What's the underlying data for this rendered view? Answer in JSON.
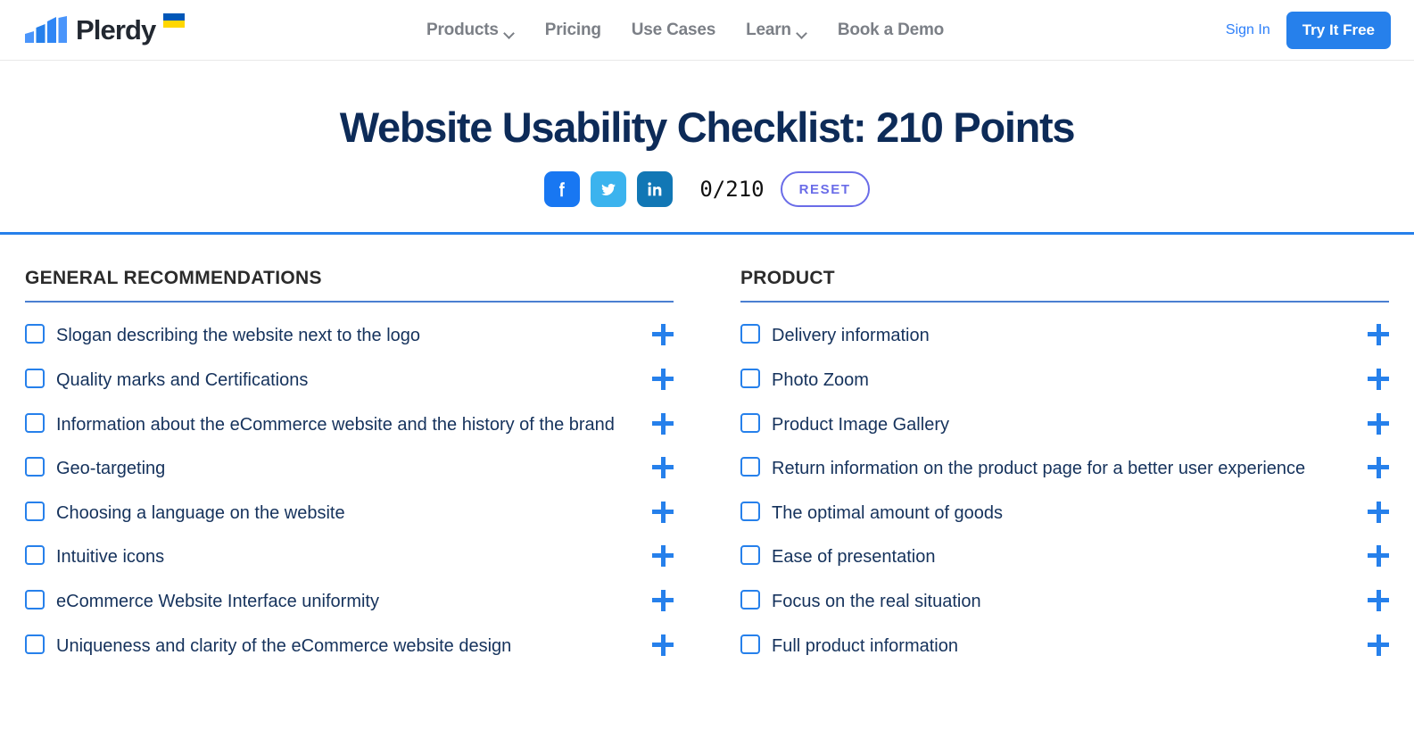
{
  "header": {
    "brand_name": "Plerdy",
    "brand_mark_icon": "bar-chart-logo-icon",
    "flag_icon": "ukraine-flag-icon",
    "nav": [
      {
        "label": "Products",
        "has_chevron": true
      },
      {
        "label": "Pricing",
        "has_chevron": false
      },
      {
        "label": "Use Cases",
        "has_chevron": false
      },
      {
        "label": "Learn",
        "has_chevron": true
      },
      {
        "label": "Book a Demo",
        "has_chevron": false
      }
    ],
    "sign_in_label": "Sign In",
    "cta_label": "Try It Free"
  },
  "hero": {
    "title": "Website Usability Checklist: 210 Points",
    "share": [
      {
        "network": "facebook",
        "icon": "facebook-icon",
        "color": "#1877f2"
      },
      {
        "network": "twitter",
        "icon": "twitter-icon",
        "color": "#3bb3ee"
      },
      {
        "network": "linkedin",
        "icon": "linkedin-icon",
        "color": "#1177b5"
      }
    ],
    "counter": "0/210",
    "reset_label": "RESET"
  },
  "colors": {
    "accent_blue": "#2680eb",
    "title_navy": "#0d2b58",
    "item_text": "#15325c",
    "reset_purple": "#6a6ce8",
    "nav_gray": "#7b7f86",
    "section_underline": "#4a7fd1"
  },
  "columns": [
    {
      "heading": "GENERAL RECOMMENDATIONS",
      "items": [
        {
          "label": "Slogan describing the website next to the logo",
          "checked": false
        },
        {
          "label": "Quality marks and Certifications",
          "checked": false
        },
        {
          "label": "Information about the eCommerce website and the history of the brand",
          "checked": false
        },
        {
          "label": "Geo-targeting",
          "checked": false
        },
        {
          "label": "Choosing a language on the website",
          "checked": false
        },
        {
          "label": "Intuitive icons",
          "checked": false
        },
        {
          "label": "eCommerce Website Interface uniformity",
          "checked": false
        },
        {
          "label": "Uniqueness and clarity of the eCommerce website design",
          "checked": false
        }
      ]
    },
    {
      "heading": "PRODUCT",
      "items": [
        {
          "label": "Delivery information",
          "checked": false
        },
        {
          "label": "Photo Zoom",
          "checked": false
        },
        {
          "label": "Product Image Gallery",
          "checked": false
        },
        {
          "label": "Return information on the product page for a better user experience",
          "checked": false
        },
        {
          "label": "The optimal amount of goods",
          "checked": false
        },
        {
          "label": "Ease of presentation",
          "checked": false
        },
        {
          "label": "Focus on the real situation",
          "checked": false
        },
        {
          "label": "Full product information",
          "checked": false
        }
      ]
    }
  ]
}
